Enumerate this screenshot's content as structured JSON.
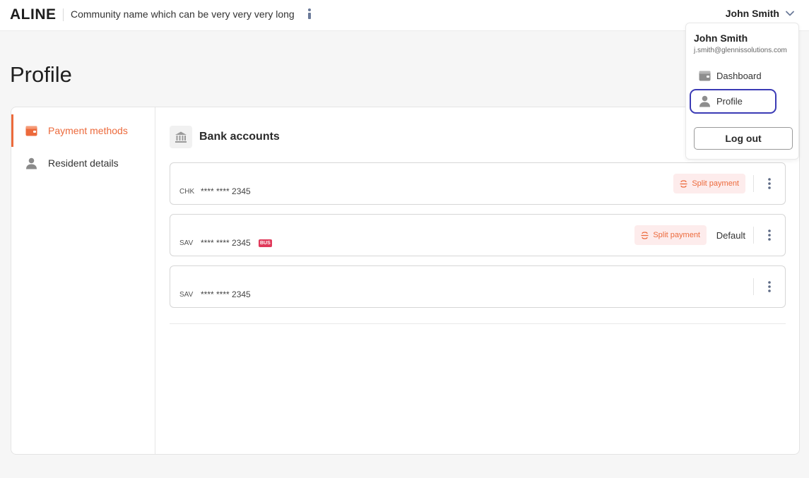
{
  "header": {
    "logo": "ALINE",
    "community_name": "Community name which can be very very  very long",
    "user_name": "John Smith"
  },
  "page": {
    "title": "Profile"
  },
  "sidenav": {
    "items": [
      {
        "label": "Payment methods",
        "icon": "wallet-icon",
        "active": true
      },
      {
        "label": "Resident details",
        "icon": "person-icon",
        "active": false
      }
    ]
  },
  "bank_accounts": {
    "title": "Bank accounts",
    "accounts": [
      {
        "type": "CHK",
        "masked_number": "**** **** 2345",
        "split_payment_label": "Split payment",
        "default_label": "",
        "badge": ""
      },
      {
        "type": "SAV",
        "masked_number": "**** **** 2345",
        "split_payment_label": "Split payment",
        "default_label": "Default",
        "badge": "BUS"
      },
      {
        "type": "SAV",
        "masked_number": "**** **** 2345",
        "split_payment_label": "",
        "default_label": "",
        "badge": ""
      }
    ]
  },
  "user_dropdown": {
    "name": "John Smith",
    "email": "j.smith@glennissolutions.com",
    "items": [
      {
        "label": "Dashboard",
        "icon": "wallet-icon"
      },
      {
        "label": "Profile",
        "icon": "person-icon"
      }
    ],
    "logout_label": "Log out"
  },
  "colors": {
    "accent": "#ec6a3c",
    "split_bg": "#fdecec",
    "bus_tag": "#e0395a",
    "focus_ring": "#3b3bb5"
  }
}
